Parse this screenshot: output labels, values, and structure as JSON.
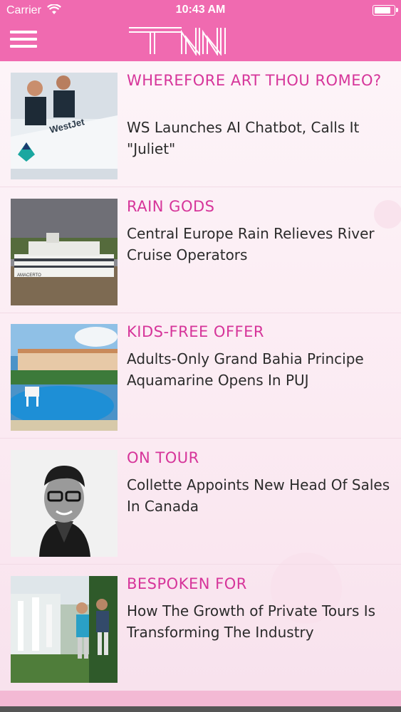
{
  "status_bar": {
    "carrier": "Carrier",
    "time": "10:43 AM",
    "battery_level": 0.9
  },
  "header": {
    "menu_icon": "hamburger-menu-icon",
    "logo_text": "TNN"
  },
  "articles": [
    {
      "kicker": "WHEREFORE ART THOU ROMEO?",
      "headline": "WS Launches AI Chatbot, Calls It \"Juliet\""
    },
    {
      "kicker": "RAIN GODS",
      "headline": "Central Europe Rain Relieves River Cruise Operators"
    },
    {
      "kicker": "KIDS-FREE OFFER",
      "headline": "Adults-Only Grand Bahia Principe Aquamarine Opens In PUJ"
    },
    {
      "kicker": "ON TOUR",
      "headline": "Collette Appoints New Head Of Sales In Canada"
    },
    {
      "kicker": "BESPOKEN FOR",
      "headline": "How The Growth of Private Tours Is Transforming The Industry"
    }
  ],
  "thumb_text": {
    "westjet": "WestJet",
    "ship": "AMACERTO"
  },
  "colors": {
    "header": "#f06ab0",
    "kicker": "#d6359a",
    "headline": "#2b2b2b"
  }
}
